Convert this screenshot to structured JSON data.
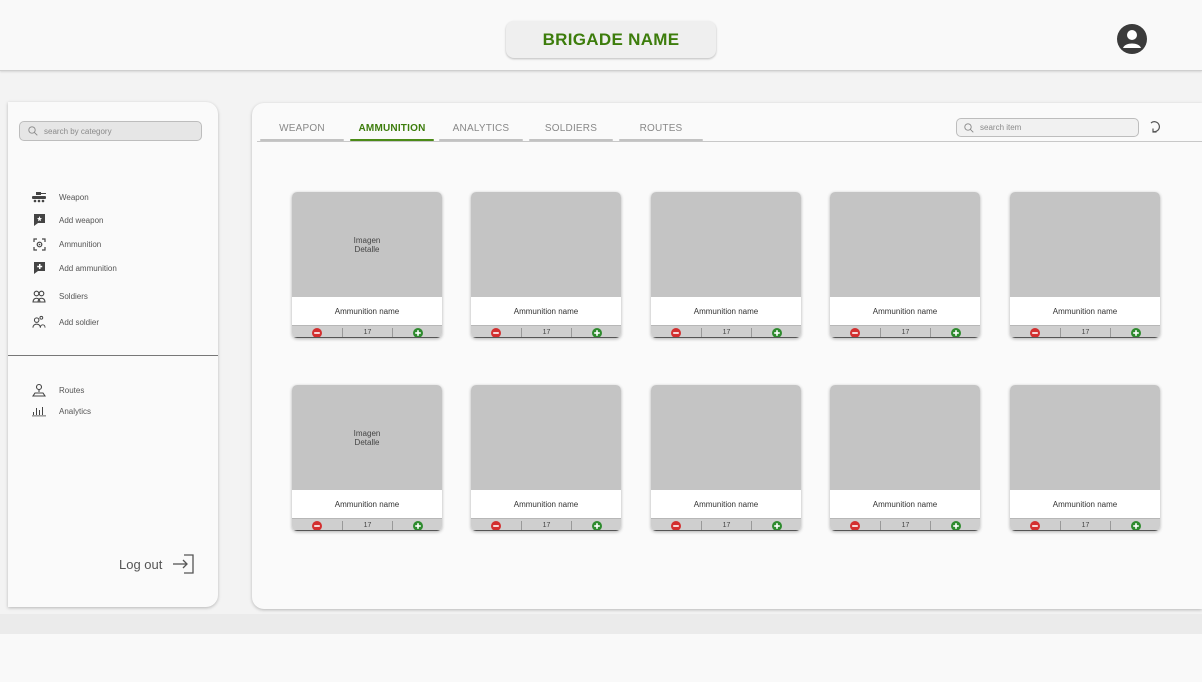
{
  "header": {
    "brand": "BRIGADE NAME"
  },
  "sidebar": {
    "search_placeholder": "search by category",
    "items": [
      {
        "label": "Weapon",
        "icon": "tank-icon"
      },
      {
        "label": "Add weapon",
        "icon": "add-weapon-icon"
      },
      {
        "label": "Ammunition",
        "icon": "ammunition-target-icon"
      },
      {
        "label": "Add ammunition",
        "icon": "add-ammunition-icon"
      },
      {
        "label": "Soldiers",
        "icon": "soldiers-icon"
      },
      {
        "label": "Add soldier",
        "icon": "add-soldier-icon"
      },
      {
        "label": "Routes",
        "icon": "routes-icon"
      },
      {
        "label": "Analytics",
        "icon": "analytics-icon"
      }
    ],
    "logout_label": "Log out"
  },
  "main": {
    "tabs": [
      {
        "label": "WEAPON",
        "active": false
      },
      {
        "label": "AMMUNITION",
        "active": true
      },
      {
        "label": "ANALYTICS",
        "active": false
      },
      {
        "label": "SOLDIERS",
        "active": false
      },
      {
        "label": "ROUTES",
        "active": false
      }
    ],
    "search_placeholder": "search item",
    "cards": [
      {
        "image_text": "Imagen\nDetalle",
        "name": "Ammunition name",
        "qty": "17"
      },
      {
        "image_text": "",
        "name": "Ammunition name",
        "qty": "17"
      },
      {
        "image_text": "",
        "name": "Ammunition name",
        "qty": "17"
      },
      {
        "image_text": "",
        "name": "Ammunition name",
        "qty": "17"
      },
      {
        "image_text": "",
        "name": "Ammunition name",
        "qty": "17"
      },
      {
        "image_text": "Imagen\nDetalle",
        "name": "Ammunition name",
        "qty": "17"
      },
      {
        "image_text": "",
        "name": "Ammunition name",
        "qty": "17"
      },
      {
        "image_text": "",
        "name": "Ammunition name",
        "qty": "17"
      },
      {
        "image_text": "",
        "name": "Ammunition name",
        "qty": "17"
      },
      {
        "image_text": "",
        "name": "Ammunition name",
        "qty": "17"
      }
    ]
  },
  "colors": {
    "accent_green": "#3d7d0c",
    "minus_red": "#d32f2f",
    "plus_green": "#2e8b2e"
  }
}
